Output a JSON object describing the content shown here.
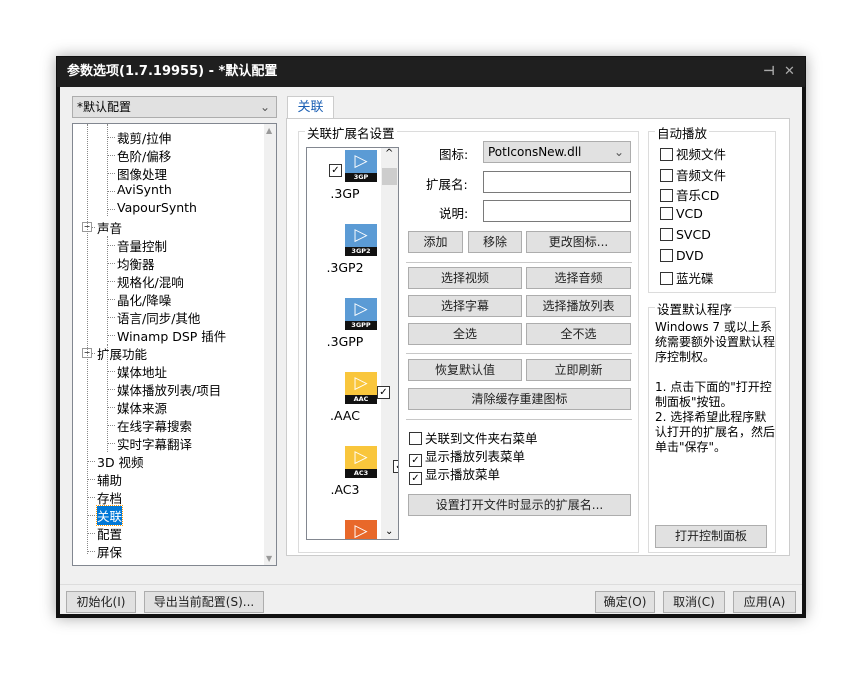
{
  "window": {
    "title": "参数选项(1.7.19955) - *默认配置",
    "pin_icon": "pin-icon",
    "close_icon": "close-icon"
  },
  "profile": {
    "selected": "*默认配置"
  },
  "tree": {
    "items": [
      {
        "label": "裁剪/拉伸",
        "level": 2
      },
      {
        "label": "色阶/偏移",
        "level": 2
      },
      {
        "label": "图像处理",
        "level": 2
      },
      {
        "label": "AviSynth",
        "level": 2
      },
      {
        "label": "VapourSynth",
        "level": 2
      },
      {
        "label": "声音",
        "level": 1,
        "expanded": true
      },
      {
        "label": "音量控制",
        "level": 2
      },
      {
        "label": "均衡器",
        "level": 2
      },
      {
        "label": "规格化/混响",
        "level": 2
      },
      {
        "label": "晶化/降噪",
        "level": 2
      },
      {
        "label": "语言/同步/其他",
        "level": 2
      },
      {
        "label": "Winamp DSP 插件",
        "level": 2
      },
      {
        "label": "扩展功能",
        "level": 1,
        "expanded": true
      },
      {
        "label": "媒体地址",
        "level": 2
      },
      {
        "label": "媒体播放列表/项目",
        "level": 2
      },
      {
        "label": "媒体来源",
        "level": 2
      },
      {
        "label": "在线字幕搜索",
        "level": 2
      },
      {
        "label": "实时字幕翻译",
        "level": 2
      },
      {
        "label": "3D 视频",
        "level": 1
      },
      {
        "label": "辅助",
        "level": 1
      },
      {
        "label": "存档",
        "level": 1
      },
      {
        "label": "关联",
        "level": 1,
        "selected": true
      },
      {
        "label": "配置",
        "level": 1
      },
      {
        "label": "屏保",
        "level": 1
      }
    ]
  },
  "tab": {
    "label": "关联"
  },
  "assoc": {
    "group_label": "关联扩展名设置",
    "files": [
      {
        "ext": ".3GP",
        "badge": "3GP",
        "color": "#5b9bd5",
        "checked": true
      },
      {
        "ext": ".3GP2",
        "badge": "3GP2",
        "color": "#5b9bd5",
        "checked": true
      },
      {
        "ext": ".3GPP",
        "badge": "3GPP",
        "color": "#5b9bd5",
        "checked": true
      },
      {
        "ext": ".AAC",
        "badge": "AAC",
        "color": "#f9c63c",
        "checked": true
      },
      {
        "ext": ".AC3",
        "badge": "AC3",
        "color": "#f9c63c",
        "checked": true
      },
      {
        "ext": "",
        "badge": "",
        "color": "#e8682a",
        "checked": true
      }
    ],
    "icon_label": "图标:",
    "icon_value": "PotIconsNew.dll",
    "ext_label": "扩展名:",
    "ext_value": "",
    "desc_label": "说明:",
    "desc_value": "",
    "buttons": {
      "add": "添加",
      "remove": "移除",
      "change_icon": "更改图标...",
      "select_video": "选择视频",
      "select_audio": "选择音频",
      "select_subtitle": "选择字幕",
      "select_playlist": "选择播放列表",
      "select_all": "全选",
      "select_none": "全不选",
      "restore_default": "恢复默认值",
      "refresh_now": "立即刷新",
      "clear_cache": "清除缓存重建图标",
      "set_open_ext": "设置打开文件时显示的扩展名..."
    },
    "options": [
      {
        "label": "关联到文件夹右菜单",
        "checked": false
      },
      {
        "label": "显示播放列表菜单",
        "checked": true
      },
      {
        "label": "显示播放菜单",
        "checked": true
      }
    ]
  },
  "autoplay": {
    "label": "自动播放",
    "items": [
      {
        "label": "视频文件",
        "checked": false
      },
      {
        "label": "音频文件",
        "checked": false
      },
      {
        "label": "音乐CD",
        "checked": false
      },
      {
        "label": "VCD",
        "checked": false
      },
      {
        "label": "SVCD",
        "checked": false
      },
      {
        "label": "DVD",
        "checked": false
      },
      {
        "label": "蓝光碟",
        "checked": false
      }
    ]
  },
  "default_prog": {
    "label": "设置默认程序",
    "text": "Windows 7 或以上系统需要额外设置默认程序控制权。\n\n1. 点击下面的\"打开控制面板\"按钮。\n2. 选择希望此程序默认打开的扩展名，然后单击\"保存\"。",
    "button": "打开控制面板"
  },
  "footer": {
    "init": "初始化(I)",
    "export": "导出当前配置(S)...",
    "ok": "确定(O)",
    "cancel": "取消(C)",
    "apply": "应用(A)"
  }
}
